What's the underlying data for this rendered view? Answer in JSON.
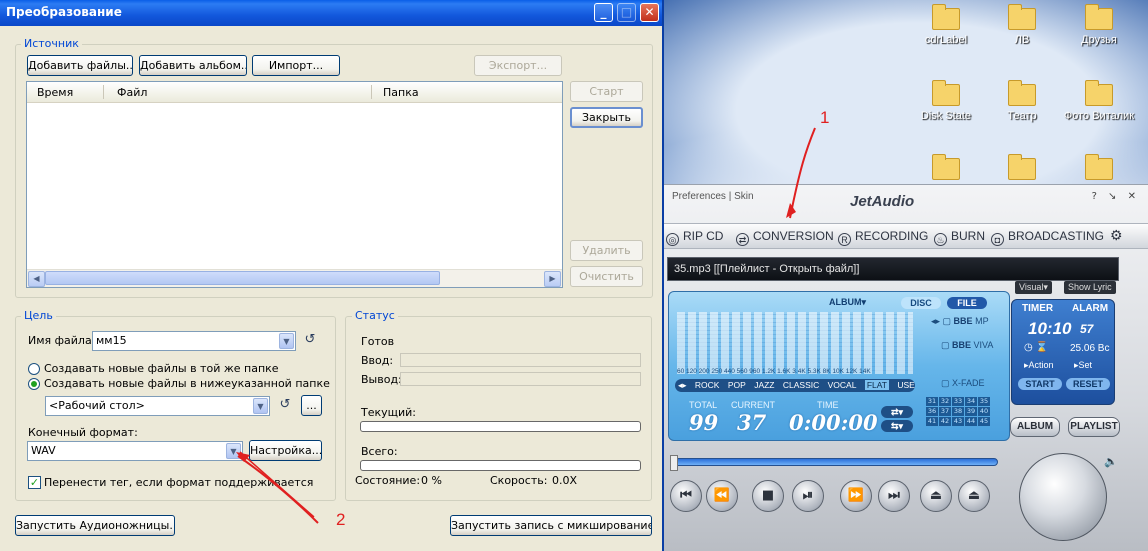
{
  "dialog": {
    "title": "Преобразование",
    "window_buttons": {
      "minimize": "_",
      "maximize": "□",
      "close": "✕"
    },
    "source": {
      "group_label": "Источник",
      "add_files": "Добавить файлы...",
      "add_album": "Добавить альбом...",
      "import": "Импорт...",
      "export": "Экспорт...",
      "columns": [
        "Время",
        "Файл",
        "Папка"
      ],
      "start": "Старт",
      "close": "Закрыть",
      "delete": "Удалить",
      "clear": "Очистить"
    },
    "target": {
      "group_label": "Цель",
      "filename_label": "Имя файла:",
      "filename_value": "мм15",
      "radio_same_folder": "Создавать новые файлы в той же папке",
      "radio_below_folder": "Создавать новые файлы в нижеуказанной папке",
      "folder_value": "<Рабочий стол>",
      "browse": "...",
      "format_label": "Конечный формат:",
      "format_value": "WAV",
      "settings": "Настройка...",
      "transfer_tag": "Перенести тег, если формат поддерживается"
    },
    "status": {
      "group_label": "Статус",
      "ready": "Готов",
      "input_label": "Ввод:",
      "output_label": "Вывод:",
      "current_label": "Текущий:",
      "total_label": "Всего:",
      "state_label": "Состояние:",
      "state_value": "0 %",
      "speed_label": "Скорость:",
      "speed_value": "0.0X"
    },
    "launch_scissors": "Запустить Аудионожницы...",
    "launch_mix_record": "Запустить запись с микшированием..."
  },
  "desktop_icons": [
    {
      "label": "cdrLabel"
    },
    {
      "label": "ЛВ"
    },
    {
      "label": "Друзья"
    },
    {
      "label": "Disk State"
    },
    {
      "label": "Театр"
    },
    {
      "label": "Фото Виталик"
    },
    {
      "label": ""
    },
    {
      "label": ""
    },
    {
      "label": ""
    }
  ],
  "jetaudio": {
    "top_links": "Preferences | Skin",
    "logo": "JetAudio",
    "win_buttons": "? ↘ ✕",
    "tabs": [
      "RIP CD",
      "CONVERSION",
      "RECORDING",
      "BURN",
      "BROADCASTING"
    ],
    "settings_icon": "⚙",
    "track_display": "35.mp3   [[Плейлист - Открыть файл]]",
    "visual_btn": "Visual▾",
    "showlyric_btn": "Show Lyric",
    "album_label": "ALBUM▾",
    "disc_btn": "DISC",
    "file_btn": "FILE",
    "freqs": "60 120 200 250 440 560 960 1.2K 1.6K 3.4K 5.3K 8K 10K 12K 14K",
    "presets": [
      "ROCK",
      "POP",
      "JAZZ",
      "CLASSIC",
      "VOCAL",
      "FLAT",
      "USER ▾"
    ],
    "preset_selected": "FLAT",
    "bbe_mp": "MP",
    "bbe_viva": "VIVA",
    "xfade": "X-FADE",
    "total_label": "TOTAL",
    "total_value": "99",
    "current_label": "CURRENT",
    "current_value": "37",
    "time_label": "TIME",
    "time_value": "0:00:00",
    "numbers": [
      "31",
      "32",
      "33",
      "34",
      "35",
      "36",
      "37",
      "38",
      "39",
      "40",
      "41",
      "42",
      "43",
      "44",
      "45"
    ],
    "timer_tab": "TIMER",
    "alarm_tab": "ALARM",
    "clock_time": "10:10",
    "clock_seconds": "57",
    "clock_date": "25.06 Bc",
    "action": "▸Action",
    "set": "▸Set",
    "start": "START",
    "reset": "RESET",
    "album_btn": "ALBUM",
    "playlist_btn": "PLAYLIST",
    "seek_progress": 0.0,
    "transport": [
      "⏮",
      "⏪",
      "■",
      "⏯",
      "⏩",
      "⏭",
      "⏏",
      "⏏"
    ]
  },
  "annotations": {
    "marker1": "1",
    "marker2": "2"
  },
  "colors": {
    "accent": "#0046d5",
    "annotation": "#e02020",
    "title_blue": "#0a5ee8"
  }
}
